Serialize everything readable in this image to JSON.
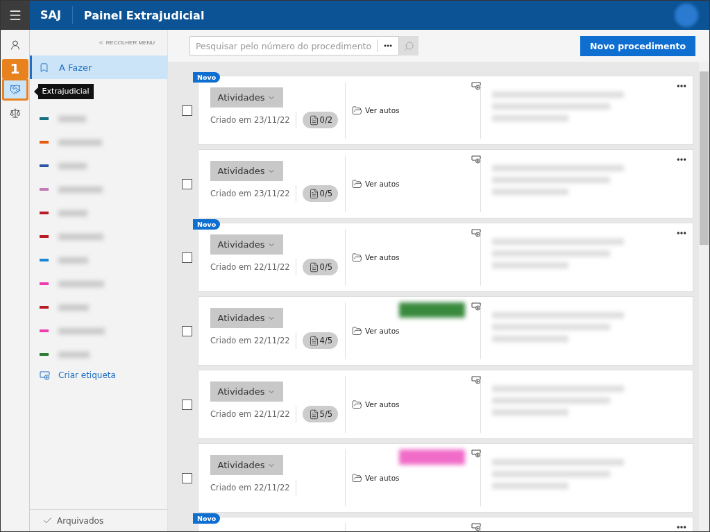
{
  "header": {
    "app": "SAJ",
    "title": "Painel Extrajudicial"
  },
  "rail": {
    "items": [
      {
        "kind": "person",
        "selected": false
      },
      {
        "kind": "handshake",
        "selected": true,
        "callout": "1",
        "tooltip": "Extrajudicial"
      },
      {
        "kind": "scale",
        "selected": false
      }
    ]
  },
  "sidebar": {
    "collapse": "RECOLHER MENU",
    "items": [
      {
        "label": "A Fazer",
        "selected": true
      }
    ],
    "tags": [
      {
        "color": "#17707f"
      },
      {
        "color": "#e8590c"
      },
      {
        "color": "#2b55a6"
      },
      {
        "color": "#c47ab8"
      },
      {
        "color": "#b81c24"
      },
      {
        "color": "#b81c24"
      },
      {
        "color": "#1a88d8"
      },
      {
        "color": "#f03cb0"
      },
      {
        "color": "#b81c24"
      },
      {
        "color": "#f03cb0"
      },
      {
        "color": "#2e7d32"
      }
    ],
    "create_tag": "Criar etiqueta",
    "archived": "Arquivados"
  },
  "toolbar": {
    "search": {
      "placeholder": "Pesquisar pelo número do procedimento"
    },
    "new_button": "Novo procedimento"
  },
  "cards": [
    {
      "novo": "Novo",
      "checked": false,
      "activities": "Atividades",
      "date": "Criado em 23/11/22",
      "count": "0/2",
      "link": "Ver autos",
      "menu": true
    },
    {
      "checked": false,
      "activities": "Atividades",
      "date": "Criado em 23/11/22",
      "count": "0/5",
      "link": "Ver autos",
      "menu": true
    },
    {
      "novo": "Novo",
      "checked": false,
      "activities": "Atividades",
      "date": "Criado em 22/11/22",
      "count": "0/5",
      "link": "Ver autos",
      "menu": true
    },
    {
      "checked": false,
      "activities": "Atividades",
      "date": "Criado em 22/11/22",
      "count": "4/5",
      "link": "Ver autos",
      "menu": false,
      "color": "#3a8a3e"
    },
    {
      "checked": false,
      "activities": "Atividades",
      "date": "Criado em 22/11/22",
      "count": "5/5",
      "link": "Ver autos",
      "menu": false
    },
    {
      "checked": false,
      "activities": "Atividades",
      "date": "Criado em 22/11/22",
      "link": "Ver autos",
      "menu": false,
      "color": "#f06cc8"
    },
    {
      "novo": "Novo",
      "menu": true
    }
  ]
}
